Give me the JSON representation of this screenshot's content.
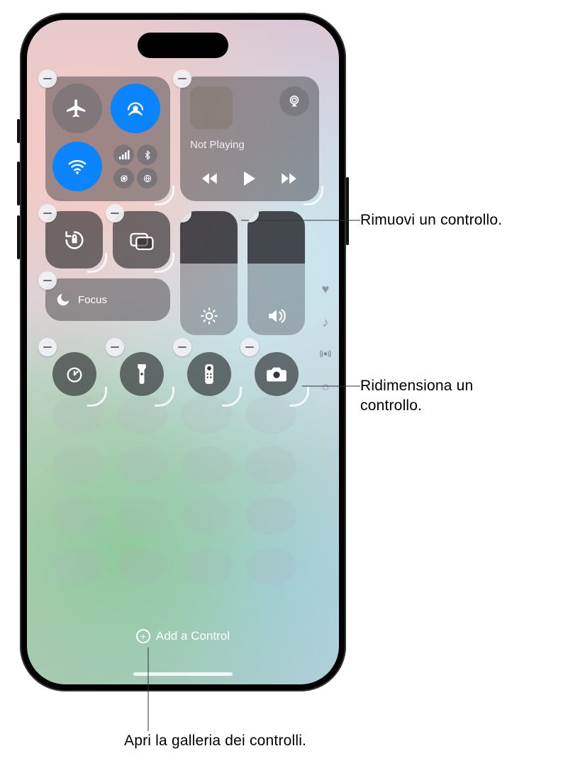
{
  "media": {
    "status": "Not Playing"
  },
  "focus": {
    "label": "Focus"
  },
  "add_control": {
    "label": "Add a Control"
  },
  "callouts": {
    "remove": "Rimuovi un controllo.",
    "resize_l1": "Ridimensiona un",
    "resize_l2": "controllo.",
    "gallery": "Apri la galleria dei controlli."
  },
  "icons": {
    "airplane": "airplane",
    "airdrop": "airdrop",
    "wifi": "wifi",
    "cellular": "cellular",
    "bluetooth": "bluetooth",
    "hotspot": "hotspot",
    "satellite": "satellite",
    "airplay": "airplay",
    "rewind": "rewind",
    "play": "play",
    "forward": "forward",
    "orientation_lock": "orientation-lock",
    "screen_mirroring": "screen-mirroring",
    "moon": "moon",
    "brightness": "brightness",
    "volume": "volume",
    "timer": "timer",
    "flashlight": "flashlight",
    "remote": "remote",
    "camera": "camera",
    "heart": "heart",
    "music_note": "music",
    "antenna": "antenna"
  }
}
